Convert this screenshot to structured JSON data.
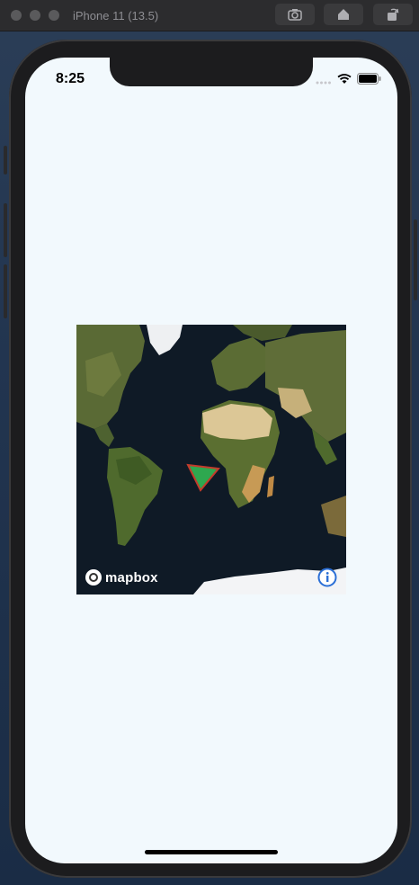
{
  "simulator": {
    "title": "iPhone 11 (13.5)",
    "buttons": [
      "screenshot",
      "home",
      "rotate"
    ]
  },
  "status_bar": {
    "time": "8:25"
  },
  "map": {
    "attribution": "mapbox",
    "colors": {
      "ocean": "#0f1a26",
      "land": "#5b6b36",
      "desert": "#d8c391",
      "ice": "#f2f2f2",
      "marker": "#2ea84f"
    },
    "icons": [
      "mapbox-logo-icon",
      "info-icon",
      "location-arrow-icon"
    ]
  }
}
